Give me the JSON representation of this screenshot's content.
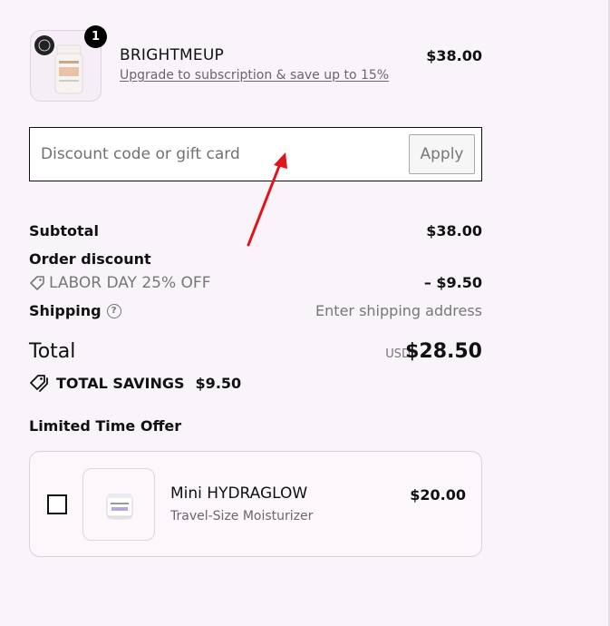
{
  "cart_item": {
    "quantity": "1",
    "name": "BRIGHTMEUP",
    "upsell_link": "Upgrade to subscription & save up to 15%",
    "price": "$38.00"
  },
  "discount": {
    "placeholder": "Discount code or gift card",
    "value": "",
    "apply_label": "Apply"
  },
  "summary": {
    "subtotal_label": "Subtotal",
    "subtotal_value": "$38.00",
    "order_discount_label": "Order discount",
    "discount_code": "LABOR DAY 25% OFF",
    "discount_value": "– $9.50",
    "shipping_label": "Shipping",
    "shipping_value": "Enter shipping address",
    "total_label": "Total",
    "currency": "USD",
    "total_value": "$28.50",
    "savings_label": "TOTAL SAVINGS",
    "savings_value": "$9.50"
  },
  "offer": {
    "title": "Limited Time Offer",
    "name": "Mini HYDRAGLOW",
    "subtitle": "Travel-Size Moisturizer",
    "price": "$20.00",
    "checked": false
  },
  "colors": {
    "background": "#f9f3fa",
    "muted_text": "#777777",
    "annotation_arrow": "#e0141b"
  },
  "icons": {
    "discount_tag": "tag-icon",
    "shipping_help": "question-circle-icon",
    "savings": "tags-icon"
  }
}
